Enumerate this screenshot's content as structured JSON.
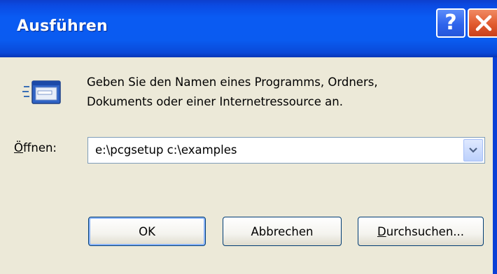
{
  "window": {
    "title": "Ausführen",
    "help_symbol": "?",
    "icons": {
      "help": "help-icon",
      "close": "close-icon",
      "app": "run-icon"
    }
  },
  "prompt": {
    "line1": "Geben Sie den Namen eines Programms, Ordners,",
    "line2": "Dokuments oder einer Internetressource an."
  },
  "open_field": {
    "label_mnemonic": "Ö",
    "label_rest": "ffnen:",
    "value": "e:\\pcgsetup c:\\examples"
  },
  "buttons": {
    "ok": "OK",
    "cancel": "Abbrechen",
    "browse_mnemonic": "D",
    "browse_rest": "urchsuchen..."
  },
  "colors": {
    "titlebar": "#0a5bf0",
    "client": "#ece9d8",
    "close": "#e15a2e",
    "help": "#2e64ec"
  }
}
